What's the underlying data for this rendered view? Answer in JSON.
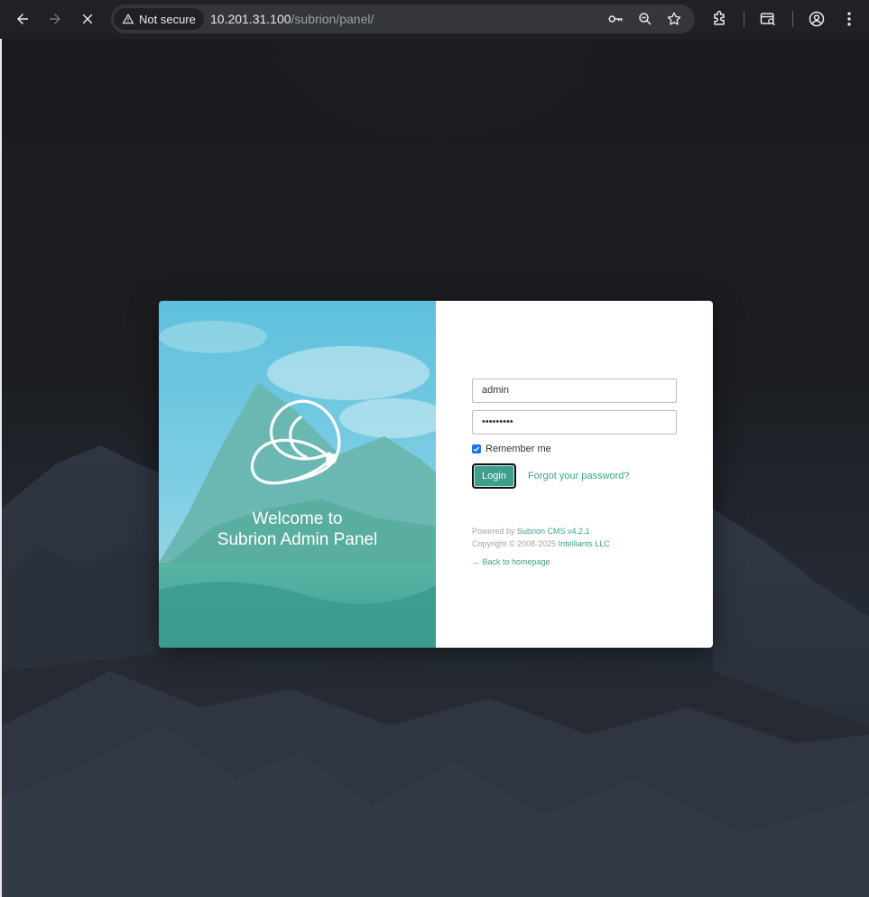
{
  "browser": {
    "security_label": "Not secure",
    "url_host": "10.201.31.100",
    "url_path": "/subrion/panel/"
  },
  "login": {
    "welcome_line1": "Welcome to",
    "welcome_line2": "Subrion Admin Panel",
    "username_value": "admin",
    "password_value": "•••••••••",
    "remember_label": "Remember me",
    "remember_checked": true,
    "login_label": "Login",
    "forgot_label": "Forgot your password?",
    "powered_prefix": "Powered by ",
    "powered_link": "Subrion CMS v4.2.1",
    "copyright_prefix": "Copyright © 2008-2025 ",
    "copyright_link": "Intelliants LLC",
    "back_label": "← Back to homepage"
  },
  "colors": {
    "accent": "#3aa290",
    "button": "#3f9f8f",
    "chrome_bg": "#202124",
    "omnibox_bg": "#35363a"
  }
}
